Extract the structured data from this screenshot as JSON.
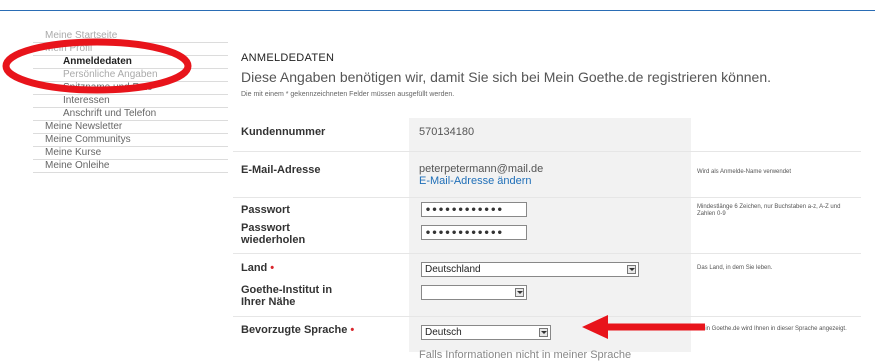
{
  "sidebar": {
    "items": [
      {
        "label": "Meine Startseite"
      },
      {
        "label": "Mein Profil"
      },
      {
        "label": "Anmeldedaten"
      },
      {
        "label": "Persönliche Angaben"
      },
      {
        "label": "Spitzname und Foto"
      },
      {
        "label": "Interessen"
      },
      {
        "label": "Anschrift und Telefon"
      },
      {
        "label": "Meine Newsletter"
      },
      {
        "label": "Meine Communitys"
      },
      {
        "label": "Meine Kurse"
      },
      {
        "label": "Meine Onleihe"
      }
    ]
  },
  "main": {
    "section_title": "ANMELDEDATEN",
    "intro": "Diese Angaben benötigen wir, damit Sie sich bei Mein Goethe.de registrieren können.",
    "required_note": "Die mit einem * gekennzeichneten Felder müssen ausgefüllt werden."
  },
  "form": {
    "customer_number_label": "Kundennummer",
    "customer_number_value": "570134180",
    "email_label": "E-Mail-Adresse",
    "email_value": "peterpetermann@mail.de",
    "email_change_link": "E-Mail-Adresse ändern",
    "email_help": "Wird als Anmelde-Name verwendet",
    "password_label": "Passwort",
    "password_value": "••••••••••••",
    "password_help": "Mindestlänge 6 Zeichen, nur Buchstaben a-z, A-Z und Zahlen 0-9",
    "password_repeat_label": "Passwort wiederholen",
    "password_repeat_value": "••••••••••••",
    "country_label": "Land",
    "required_mark": "•",
    "country_value": "Deutschland",
    "country_help": "Das Land, in dem Sie leben.",
    "goethe_label": "Goethe-Institut in Ihrer Nähe",
    "goethe_value": "",
    "language_label": "Bevorzugte Sprache",
    "language_value": "Deutsch",
    "language_help": "Mein Goethe.de wird Ihnen in dieser Sprache angezeigt.",
    "bottom_text": "Falls Informationen nicht in meiner Sprache"
  },
  "colors": {
    "annotation_red": "#e8141b",
    "link_blue": "#1f6fb8",
    "top_line": "#2a6db5"
  }
}
